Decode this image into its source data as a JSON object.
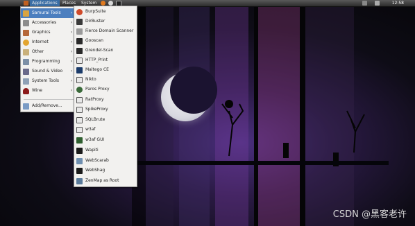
{
  "panel": {
    "menus": [
      "Applications",
      "Places",
      "System"
    ],
    "clock": "12:58",
    "icons": [
      "gnome-foot-icon",
      "firefox-icon",
      "help-icon",
      "terminal-icon",
      "network-icon",
      "volume-icon"
    ]
  },
  "main_menu": {
    "items": [
      {
        "label": "Samurai Tools",
        "icon": "folder-icon",
        "submenu": true,
        "highlighted": true
      },
      {
        "label": "Accessories",
        "icon": "accessories-icon",
        "submenu": true
      },
      {
        "label": "Graphics",
        "icon": "graphics-icon",
        "submenu": true
      },
      {
        "label": "Internet",
        "icon": "internet-icon",
        "submenu": true
      },
      {
        "label": "Other",
        "icon": "other-icon",
        "submenu": true
      },
      {
        "label": "Programming",
        "icon": "programming-icon",
        "submenu": true
      },
      {
        "label": "Sound & Video",
        "icon": "sound-video-icon",
        "submenu": true
      },
      {
        "label": "System Tools",
        "icon": "system-tools-icon",
        "submenu": true
      },
      {
        "label": "Wine",
        "icon": "wine-icon",
        "submenu": true
      }
    ],
    "footer_item": {
      "label": "Add/Remove...",
      "icon": "add-remove-icon"
    }
  },
  "samurai_menu": {
    "items": [
      {
        "label": "BurpSuite",
        "icon": "burpsuite-icon"
      },
      {
        "label": "DirBuster",
        "icon": "dirbuster-icon"
      },
      {
        "label": "Fierce Domain Scanner",
        "icon": "fierce-icon"
      },
      {
        "label": "Gooscan",
        "icon": "gooscan-icon"
      },
      {
        "label": "Grendel-Scan",
        "icon": "grendel-scan-icon"
      },
      {
        "label": "HTTP_Print",
        "icon": "httprint-icon"
      },
      {
        "label": "Maltego CE",
        "icon": "maltego-icon"
      },
      {
        "label": "Nikto",
        "icon": "nikto-icon"
      },
      {
        "label": "Paros Proxy",
        "icon": "paros-icon"
      },
      {
        "label": "RatProxy",
        "icon": "ratproxy-icon"
      },
      {
        "label": "SpikeProxy",
        "icon": "spikeproxy-icon"
      },
      {
        "label": "SQLBrute",
        "icon": "sqlbrute-icon"
      },
      {
        "label": "w3af",
        "icon": "w3af-icon"
      },
      {
        "label": "w3af GUI",
        "icon": "w3af-gui-icon"
      },
      {
        "label": "Wapiti",
        "icon": "wapiti-icon"
      },
      {
        "label": "WebScarab",
        "icon": "webscarab-icon"
      },
      {
        "label": "WebShag",
        "icon": "webshag-icon"
      },
      {
        "label": "ZenMap as Root",
        "icon": "zenmap-icon"
      }
    ]
  },
  "watermark": "CSDN @黑客老许",
  "colors": {
    "highlight": "#4c7fbf",
    "menu_bg": "#f2f1ef"
  }
}
